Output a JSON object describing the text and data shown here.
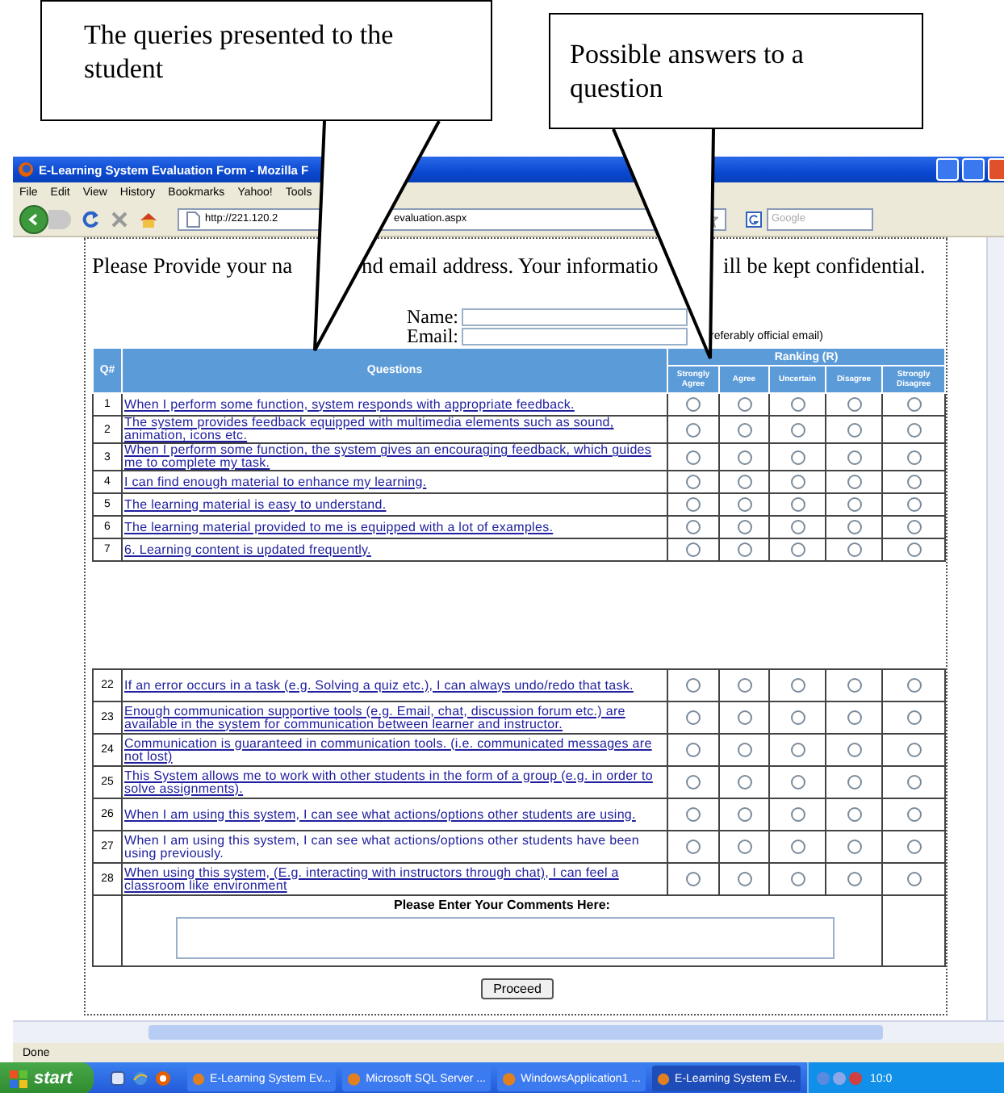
{
  "callouts": [
    {
      "text": "The queries presented to the student"
    },
    {
      "text": "Possible answers to a question"
    }
  ],
  "window": {
    "title": "E-Learning System Evaluation Form - Mozilla F"
  },
  "menu": [
    "File",
    "Edit",
    "View",
    "History",
    "Bookmarks",
    "Yahoo!",
    "Tools"
  ],
  "address_bar": {
    "url_start": "http://221.120.2",
    "url_end": "evaluation.aspx"
  },
  "search": {
    "placeholder": "Google"
  },
  "page": {
    "intro": [
      "Please Provide your na",
      "nd email address. Your informatio",
      "ill be kept confidential."
    ],
    "fields": [
      {
        "label": "Name:"
      },
      {
        "label": "Email:",
        "hint": "referably official email)"
      }
    ],
    "table": {
      "columns": [
        "Q#",
        "Questions"
      ],
      "group": "Ranking (R)",
      "ratings": [
        "Strongly Agree",
        "Agree",
        "Uncertain",
        "Disagree",
        "Strongly Disagree"
      ],
      "sections": [
        {
          "rows": [
            {
              "number": "1",
              "kind": "link",
              "text": "When I perform some function, system responds with appropriate feedback.",
              "options": [
                {
                  "selected": false
                },
                {
                  "selected": false
                },
                {
                  "selected": false
                },
                {
                  "selected": false
                },
                {
                  "selected": false
                }
              ]
            },
            {
              "number": "2",
              "kind": "link",
              "text": "The system provides feedback equipped with multimedia elements such as sound, animation, icons etc.",
              "options": [
                {
                  "selected": false
                },
                {
                  "selected": false
                },
                {
                  "selected": false
                },
                {
                  "selected": false
                },
                {
                  "selected": false
                }
              ]
            },
            {
              "number": "3",
              "kind": "link",
              "text": "When I perform some function, the system gives an encouraging feedback, which guides me to complete my task.",
              "options": [
                {
                  "selected": false
                },
                {
                  "selected": false
                },
                {
                  "selected": false
                },
                {
                  "selected": false
                },
                {
                  "selected": false
                }
              ]
            },
            {
              "number": "4",
              "kind": "link",
              "text": "I can find enough material to enhance my learning.",
              "options": [
                {
                  "selected": false
                },
                {
                  "selected": false
                },
                {
                  "selected": false
                },
                {
                  "selected": false
                },
                {
                  "selected": false
                }
              ]
            },
            {
              "number": "5",
              "kind": "link",
              "text": "The learning material is easy to understand.",
              "options": [
                {
                  "selected": false
                },
                {
                  "selected": false
                },
                {
                  "selected": false
                },
                {
                  "selected": false
                },
                {
                  "selected": false
                }
              ]
            },
            {
              "number": "6",
              "kind": "link",
              "text": "The learning material provided to me is equipped with a lot of examples.",
              "options": [
                {
                  "selected": false
                },
                {
                  "selected": false
                },
                {
                  "selected": false
                },
                {
                  "selected": false
                },
                {
                  "selected": false
                }
              ]
            },
            {
              "number": "7",
              "kind": "link",
              "text": "6. Learning content is updated frequently.",
              "options": [
                {
                  "selected": false
                },
                {
                  "selected": false
                },
                {
                  "selected": false
                },
                {
                  "selected": false
                },
                {
                  "selected": false
                }
              ]
            }
          ]
        },
        {
          "rows": [
            {
              "number": "22",
              "kind": "link",
              "text": "If an error occurs in a task (e.g. Solving a quiz etc.), I can always undo/redo that task.",
              "options": [
                {
                  "selected": false
                },
                {
                  "selected": false
                },
                {
                  "selected": false
                },
                {
                  "selected": false
                },
                {
                  "selected": false
                }
              ]
            },
            {
              "number": "23",
              "kind": "link",
              "text": "Enough communication supportive tools (e.g. Email, chat, discussion forum etc.) are available in the system for communication between learner and instructor.",
              "options": [
                {
                  "selected": false
                },
                {
                  "selected": false
                },
                {
                  "selected": false
                },
                {
                  "selected": false
                },
                {
                  "selected": false
                }
              ]
            },
            {
              "number": "24",
              "kind": "link",
              "text": "Communication is guaranteed in communication tools. (i.e. communicated messages are not lost)",
              "options": [
                {
                  "selected": false
                },
                {
                  "selected": false
                },
                {
                  "selected": false
                },
                {
                  "selected": false
                },
                {
                  "selected": false
                }
              ]
            },
            {
              "number": "25",
              "kind": "link",
              "text": "This System allows me to work with other students in the form of a group (e.g. in order to solve assignments).",
              "options": [
                {
                  "selected": false
                },
                {
                  "selected": false
                },
                {
                  "selected": false
                },
                {
                  "selected": false
                },
                {
                  "selected": false
                }
              ]
            },
            {
              "number": "26",
              "kind": "link",
              "text": "When I am using this system, I can see what actions/options other students are using.",
              "options": [
                {
                  "selected": false
                },
                {
                  "selected": false
                },
                {
                  "selected": false
                },
                {
                  "selected": false
                },
                {
                  "selected": false
                }
              ]
            },
            {
              "number": "27",
              "kind": "text",
              "text": "When I am using this system, I can see what actions/options other students have been using previously.",
              "options": [
                {
                  "selected": false
                },
                {
                  "selected": false
                },
                {
                  "selected": false
                },
                {
                  "selected": false
                },
                {
                  "selected": false
                }
              ]
            },
            {
              "number": "28",
              "kind": "link",
              "text": "When using this system, (E.g. interacting with instructors through chat), I can feel a classroom like environment",
              "options": [
                {
                  "selected": false
                },
                {
                  "selected": false
                },
                {
                  "selected": false
                },
                {
                  "selected": false
                },
                {
                  "selected": false
                }
              ]
            }
          ]
        }
      ]
    },
    "comments": {
      "label": "Please Enter Your Comments Here:"
    },
    "button": "Proceed"
  },
  "status_bar": "Done",
  "taskbar": {
    "start": "start",
    "tasks": [
      {
        "label": "E-Learning System Ev...",
        "selected": false
      },
      {
        "label": "Microsoft SQL Server ...",
        "selected": false
      },
      {
        "label": "WindowsApplication1 ...",
        "selected": false
      },
      {
        "label": "E-Learning System Ev...",
        "selected": true
      }
    ],
    "clock": "10:0"
  }
}
